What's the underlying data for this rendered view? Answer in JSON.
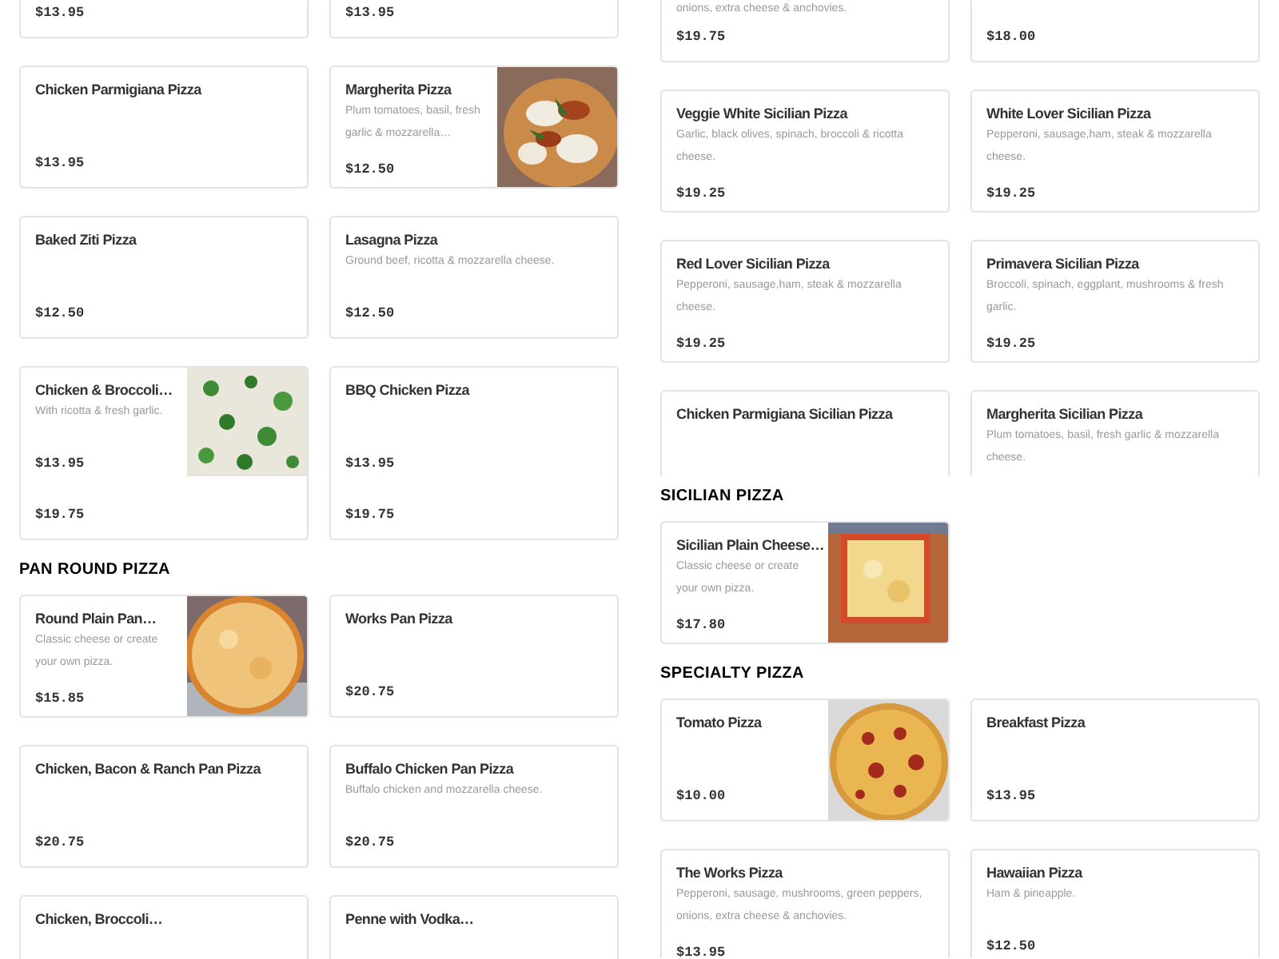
{
  "columns": [
    {
      "blocks": [
        {
          "kind": "row",
          "cards": [
            {
              "kind": "plain",
              "price": "$13.95"
            },
            {
              "kind": "plain",
              "price": "$13.95"
            }
          ]
        },
        {
          "kind": "row",
          "cards": [
            {
              "kind": "plain",
              "title": "Chicken Parmigiana Pizza",
              "price": "$13.95"
            },
            {
              "kind": "picture",
              "title": "Margherita Pizza",
              "description": "Plum tomatoes, basil, fresh garlic & mozzarella…",
              "price": "$12.50"
            }
          ]
        },
        {
          "kind": "row",
          "cards": [
            {
              "kind": "plain",
              "title": "Baked Ziti Pizza",
              "price": "$12.50"
            },
            {
              "kind": "plain",
              "title": "Lasagna Pizza",
              "description": "Ground beef, ricotta & mozzarella cheese.",
              "price": "$12.50"
            }
          ]
        },
        {
          "kind": "row",
          "cards": [
            {
              "kind": "picture",
              "title": "Chicken & Broccoli…",
              "description": "With ricotta & fresh garlic.",
              "price": "$13.95"
            },
            {
              "kind": "plain",
              "title": "BBQ Chicken Pizza",
              "price": "$13.95"
            }
          ]
        },
        {
          "kind": "row",
          "cards": [
            {
              "kind": "plain",
              "price": "$19.75"
            },
            {
              "kind": "plain",
              "price": "$19.75"
            }
          ]
        },
        {
          "kind": "heading",
          "text": "PAN ROUND PIZZA"
        },
        {
          "kind": "row",
          "cards": [
            {
              "kind": "picture",
              "title": "Round Plain Pan…",
              "description": "Classic cheese or create your own pizza.",
              "price": "$15.85"
            },
            {
              "kind": "plain",
              "title": "Works Pan Pizza",
              "price": "$20.75"
            }
          ]
        },
        {
          "kind": "row",
          "cards": [
            {
              "kind": "plain",
              "title": "Chicken, Bacon & Ranch Pan Pizza",
              "price": "$20.75"
            },
            {
              "kind": "plain",
              "title": "Buffalo Chicken Pan Pizza",
              "description": "Buffalo chicken and mozzarella cheese.",
              "price": "$20.75"
            }
          ]
        },
        {
          "kind": "row",
          "cards": [
            {
              "kind": "plain",
              "title": "Chicken, Broccoli…"
            },
            {
              "kind": "plain",
              "title": "Penne with Vodka…"
            }
          ]
        }
      ]
    },
    {
      "blocks": [
        {
          "kind": "row",
          "cards": [
            {
              "kind": "plain",
              "description": "onions, extra cheese & anchovies.",
              "price": "$19.75"
            },
            {
              "kind": "plain",
              "price": "$18.00"
            }
          ]
        },
        {
          "kind": "row",
          "cards": [
            {
              "kind": "plain",
              "title": "Veggie White Sicilian Pizza",
              "description": "Garlic, black olives, spinach, broccoli & ricotta cheese.",
              "price": "$19.25"
            },
            {
              "kind": "plain",
              "title": "White Lover Sicilian Pizza",
              "description": "Pepperoni, sausage,ham, steak & mozzarella cheese.",
              "price": "$19.25"
            }
          ]
        },
        {
          "kind": "row",
          "cards": [
            {
              "kind": "plain",
              "title": "Red Lover Sicilian Pizza",
              "description": "Pepperoni, sausage,ham, steak & mozzarella cheese.",
              "price": "$19.25"
            },
            {
              "kind": "plain",
              "title": "Primavera Sicilian Pizza",
              "description": "Broccoli, spinach, eggplant, mushrooms & fresh garlic.",
              "price": "$19.25"
            }
          ]
        },
        {
          "kind": "row",
          "cards": [
            {
              "kind": "plain",
              "title": "Chicken Parmigiana Sicilian Pizza"
            },
            {
              "kind": "plain",
              "title": "Margherita Sicilian Pizza",
              "description": "Plum tomatoes, basil, fresh garlic & mozzarella cheese."
            }
          ]
        },
        {
          "kind": "heading",
          "text": "SICILIAN PIZZA"
        },
        {
          "kind": "row",
          "cards": [
            {
              "kind": "picture",
              "title": "Sicilian Plain Cheese…",
              "description": "Classic cheese or create your own pizza.",
              "price": "$17.80"
            }
          ]
        },
        {
          "kind": "heading",
          "text": "SPECIALTY PIZZA"
        },
        {
          "kind": "row",
          "cards": [
            {
              "kind": "picture",
              "title": "Tomato Pizza",
              "price": "$10.00"
            },
            {
              "kind": "plain",
              "title": "Breakfast Pizza",
              "price": "$13.95"
            }
          ]
        },
        {
          "kind": "row",
          "cards": [
            {
              "kind": "plain",
              "title": "The Works Pizza",
              "description": "Pepperoni, sausage, mushrooms, green peppers, onions, extra cheese & anchovies.",
              "price": "$13.95"
            },
            {
              "kind": "plain",
              "title": "Hawaiian Pizza",
              "description": "Ham & pineapple.",
              "price": "$12.50"
            }
          ]
        }
      ]
    }
  ]
}
